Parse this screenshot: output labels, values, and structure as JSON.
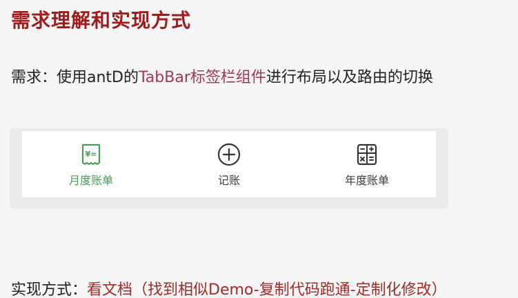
{
  "slide": {
    "title": "需求理解和实现方式",
    "requirement": {
      "prefix": "需求：使用antD的",
      "highlight": "TabBar标签栏组件",
      "suffix": "进行布局以及路由的切换"
    },
    "implementation": {
      "prefix": "实现方式：",
      "highlight": "看文档（找到相似Demo-复制代码跑通-定制化修改）"
    }
  },
  "tabbar": {
    "active_color": "#4a9a5a",
    "inactive_color": "#3a3a3a",
    "tabs": [
      {
        "label": "月度账单",
        "icon": "monthly-bill-icon",
        "active": true
      },
      {
        "label": "记账",
        "icon": "add-circle-icon",
        "active": false
      },
      {
        "label": "年度账单",
        "icon": "calculator-icon",
        "active": false
      }
    ]
  }
}
